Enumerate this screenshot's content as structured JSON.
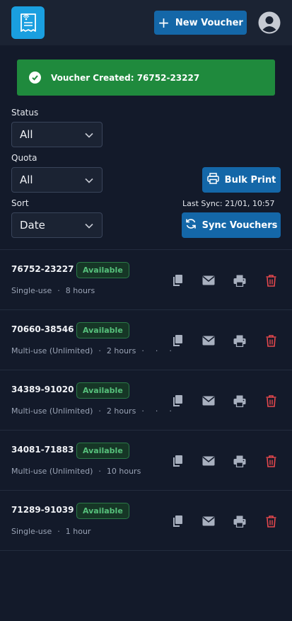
{
  "header": {
    "new_voucher_label": "New Voucher",
    "logo_icon": "receipt-wifi-icon",
    "avatar_icon": "user-circle-icon"
  },
  "toast": {
    "text": "Voucher Created: 76752-23227",
    "icon": "check-circle-icon",
    "color": "#1f8a3d"
  },
  "filters": {
    "status": {
      "label": "Status",
      "value": "All"
    },
    "quota": {
      "label": "Quota",
      "value": "All"
    },
    "sort": {
      "label": "Sort",
      "value": "Date"
    }
  },
  "actions": {
    "bulk_print_label": "Bulk Print",
    "last_sync": "Last Sync: 21/01, 10:57",
    "sync_label": "Sync Vouchers"
  },
  "vouchers": [
    {
      "code": "76752-23227",
      "status": "Available",
      "type": "Single-use",
      "duration": "8 hours",
      "extra_dots": false
    },
    {
      "code": "70660-38546",
      "status": "Available",
      "type": "Multi-use (Unlimited)",
      "duration": "2 hours",
      "extra_dots": true
    },
    {
      "code": "34389-91020",
      "status": "Available",
      "type": "Multi-use (Unlimited)",
      "duration": "2 hours",
      "extra_dots": true
    },
    {
      "code": "34081-71883",
      "status": "Available",
      "type": "Multi-use (Unlimited)",
      "duration": "10 hours",
      "extra_dots": false
    },
    {
      "code": "71289-91039",
      "status": "Available",
      "type": "Single-use",
      "duration": "1 hour",
      "extra_dots": false
    }
  ],
  "colors": {
    "accent": "#1467a8",
    "available": "#56c07b",
    "delete": "#e5484d",
    "background": "#131a2a"
  }
}
